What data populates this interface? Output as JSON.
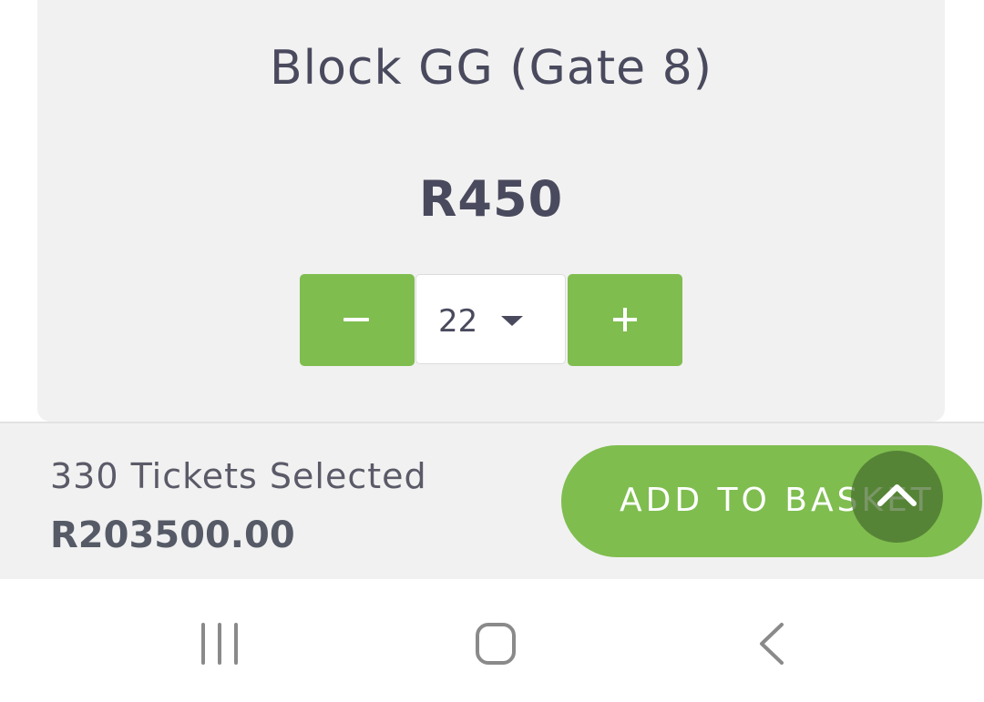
{
  "ticket": {
    "block_name": "Block GG (Gate 8)",
    "price": "R450",
    "quantity": "22"
  },
  "summary": {
    "tickets_selected": "330 Tickets Selected",
    "total": "R203500.00",
    "add_to_basket_label": "ADD TO BASKET"
  },
  "colors": {
    "accent_green": "#7fbd4f",
    "text_dark": "#4a4a5e",
    "panel_bg": "#f1f1f1"
  },
  "icons": {
    "decrement": "minus-icon",
    "increment": "plus-icon",
    "dropdown": "caret-down-icon",
    "scroll_top": "chevron-up-icon",
    "nav_recents": "recent-apps-icon",
    "nav_home": "home-icon",
    "nav_back": "back-icon"
  }
}
